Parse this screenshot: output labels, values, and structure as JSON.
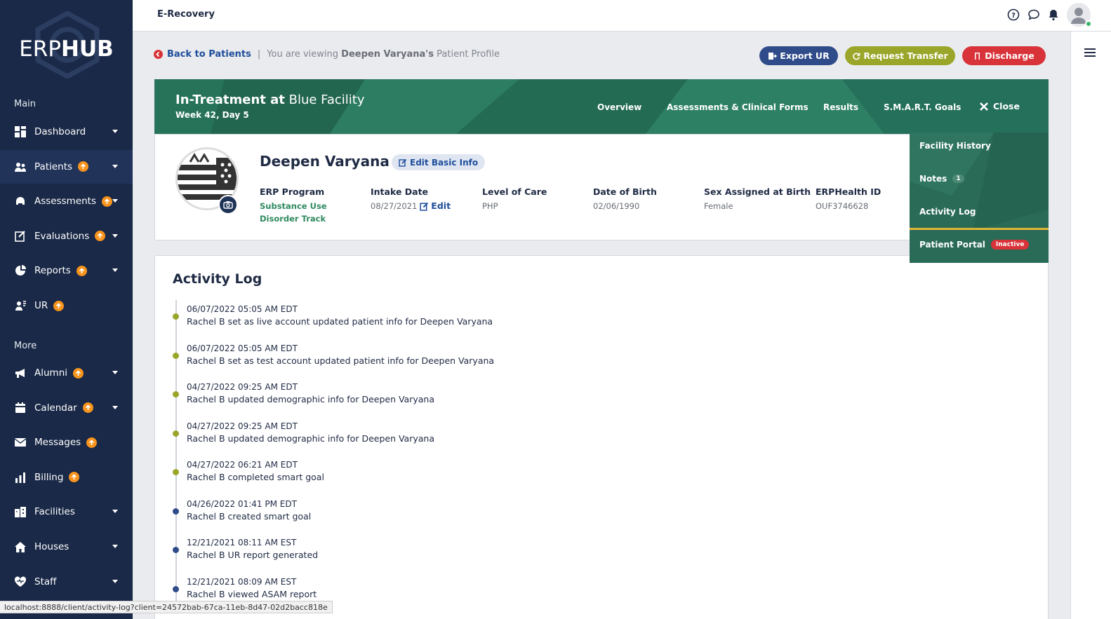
{
  "app": {
    "title": "E-Recovery",
    "logo_text_light": "ERP",
    "logo_text_bold": "HUB"
  },
  "sidebar": {
    "main_label": "Main",
    "more_label": "More",
    "main_items": [
      {
        "label": "Dashboard",
        "icon": "dashboard-icon",
        "badge": false,
        "caret": true
      },
      {
        "label": "Patients",
        "icon": "patients-icon",
        "badge": true,
        "caret": true
      },
      {
        "label": "Assessments",
        "icon": "assessments-icon",
        "badge": true,
        "caret": true
      },
      {
        "label": "Evaluations",
        "icon": "evaluations-icon",
        "badge": true,
        "caret": true
      },
      {
        "label": "Reports",
        "icon": "reports-icon",
        "badge": true,
        "caret": true
      },
      {
        "label": "UR",
        "icon": "ur-icon",
        "badge": true,
        "caret": false
      }
    ],
    "more_items": [
      {
        "label": "Alumni",
        "icon": "alumni-icon",
        "badge": true,
        "caret": true
      },
      {
        "label": "Calendar",
        "icon": "calendar-icon",
        "badge": true,
        "caret": true
      },
      {
        "label": "Messages",
        "icon": "messages-icon",
        "badge": true,
        "caret": false
      },
      {
        "label": "Billing",
        "icon": "billing-icon",
        "badge": true,
        "caret": false
      },
      {
        "label": "Facilities",
        "icon": "facilities-icon",
        "badge": false,
        "caret": true
      },
      {
        "label": "Houses",
        "icon": "houses-icon",
        "badge": false,
        "caret": true
      },
      {
        "label": "Staff",
        "icon": "staff-icon",
        "badge": false,
        "caret": true
      }
    ]
  },
  "breadcrumb": {
    "back_label": "Back to Patients",
    "separator": "|",
    "viewing_prefix": "You are viewing",
    "patient_possessive": "Deepen Varyana's",
    "viewing_suffix": "Patient Profile"
  },
  "actions": {
    "export": "Export UR",
    "transfer": "Request Transfer",
    "discharge": "Discharge"
  },
  "banner": {
    "status_bold": "In-Treatment at",
    "facility": "Blue Facility",
    "week": "Week 42, Day 5",
    "tabs": [
      "Overview",
      "Assessments & Clinical Forms",
      "Results",
      "S.M.A.R.T. Goals"
    ],
    "close_label": "Close"
  },
  "patient": {
    "name": "Deepen Varyana",
    "edit_basic": "Edit Basic Info",
    "fields": {
      "program_label": "ERP Program",
      "program_value": "Substance Use Disorder Track",
      "intake_label": "Intake Date",
      "intake_value": "08/27/2021",
      "intake_edit": "Edit",
      "loc_label": "Level of Care",
      "loc_value": "PHP",
      "dob_label": "Date of Birth",
      "dob_value": "02/06/1990",
      "sex_label": "Sex Assigned at Birth",
      "sex_value": "Female",
      "id_label": "ERPHealth ID",
      "id_value": "OUF3746628"
    }
  },
  "menu": {
    "facility_history": "Facility History",
    "notes": "Notes",
    "notes_count": "1",
    "activity_log": "Activity Log",
    "patient_portal": "Patient Portal",
    "portal_status": "Inactive"
  },
  "activity": {
    "title": "Activity Log",
    "entries": [
      {
        "date": "06/07/2022 05:05 AM EDT",
        "text": "Rachel B set as live account updated patient info for Deepen Varyana",
        "color": "#9aa629"
      },
      {
        "date": "06/07/2022 05:05 AM EDT",
        "text": "Rachel B set as test account updated patient info for Deepen Varyana",
        "color": "#9aa629"
      },
      {
        "date": "04/27/2022 09:25 AM EDT",
        "text": "Rachel B updated demographic info for Deepen Varyana",
        "color": "#9aa629"
      },
      {
        "date": "04/27/2022 09:25 AM EDT",
        "text": "Rachel B updated demographic info for Deepen Varyana",
        "color": "#9aa629"
      },
      {
        "date": "04/27/2022 06:21 AM EDT",
        "text": "Rachel B completed smart goal",
        "color": "#9aa629"
      },
      {
        "date": "04/26/2022 01:41 PM EDT",
        "text": "Rachel B created smart goal",
        "color": "#2f4b8a"
      },
      {
        "date": "12/21/2021 08:11 AM EST",
        "text": "Rachel B UR report generated",
        "color": "#2f4b8a"
      },
      {
        "date": "12/21/2021 08:09 AM EST",
        "text": "Rachel B viewed ASAM report",
        "color": "#2f4b8a"
      }
    ]
  },
  "statusbar": {
    "url": "localhost:8888/client/activity-log?client=24572bab-67ca-11eb-8d47-02d2bacc818e"
  },
  "colors": {
    "sidebar": "#1a2947",
    "banner": "#27735a",
    "export": "#2f4b8a",
    "transfer": "#9aa629",
    "discharge": "#d9333a",
    "badge": "#f7941d"
  }
}
